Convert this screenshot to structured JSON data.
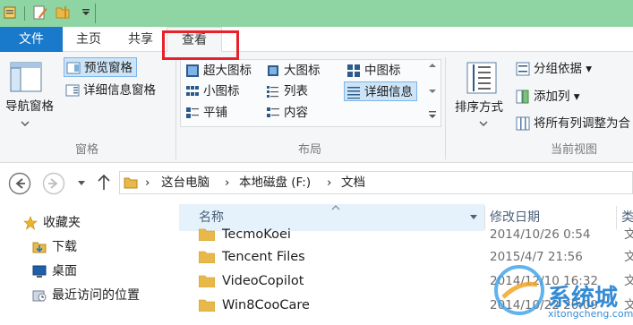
{
  "ribbon_tabs": {
    "file": "文件",
    "home": "主页",
    "share": "共享",
    "view": "查看"
  },
  "panes_group": {
    "label": "窗格",
    "nav_pane": "导航窗格",
    "preview_pane": "预览窗格",
    "details_pane": "详细信息窗格"
  },
  "layout_group": {
    "label": "布局",
    "extra_large_icons": "超大图标",
    "large_icons": "大图标",
    "medium_icons": "中图标",
    "small_icons": "小图标",
    "list": "列表",
    "details": "详细信息",
    "tiles": "平铺",
    "content": "内容"
  },
  "current_view_group": {
    "label": "当前视图",
    "sort_by": "排序方式",
    "group_by": "分组依据",
    "add_columns": "添加列",
    "size_all_columns": "将所有列调整为合"
  },
  "breadcrumb": [
    "这台电脑",
    "本地磁盘 (F:)",
    "文档"
  ],
  "navigation": {
    "favorites": "收藏夹",
    "downloads": "下载",
    "desktop": "桌面",
    "recent_places": "最近访问的位置"
  },
  "columns": {
    "name": "名称",
    "date_modified": "修改日期",
    "type": "类"
  },
  "files": [
    {
      "name": "TecmoKoei",
      "date": "2014/10/26 0:54",
      "type": "文"
    },
    {
      "name": "Tencent Files",
      "date": "2015/4/7 21:56",
      "type": "文"
    },
    {
      "name": "VideoCopilot",
      "date": "2014/12/10 16:32",
      "type": "文"
    },
    {
      "name": "Win8CooCare",
      "date": "2014/10/22 20:09",
      "type": "文"
    }
  ],
  "watermark": {
    "brand": "系统城",
    "url": "xitongcheng.com"
  },
  "colors": {
    "accent": "#1979ca",
    "title_bar": "#8fd4a3",
    "highlight_box": "#e8202a"
  }
}
